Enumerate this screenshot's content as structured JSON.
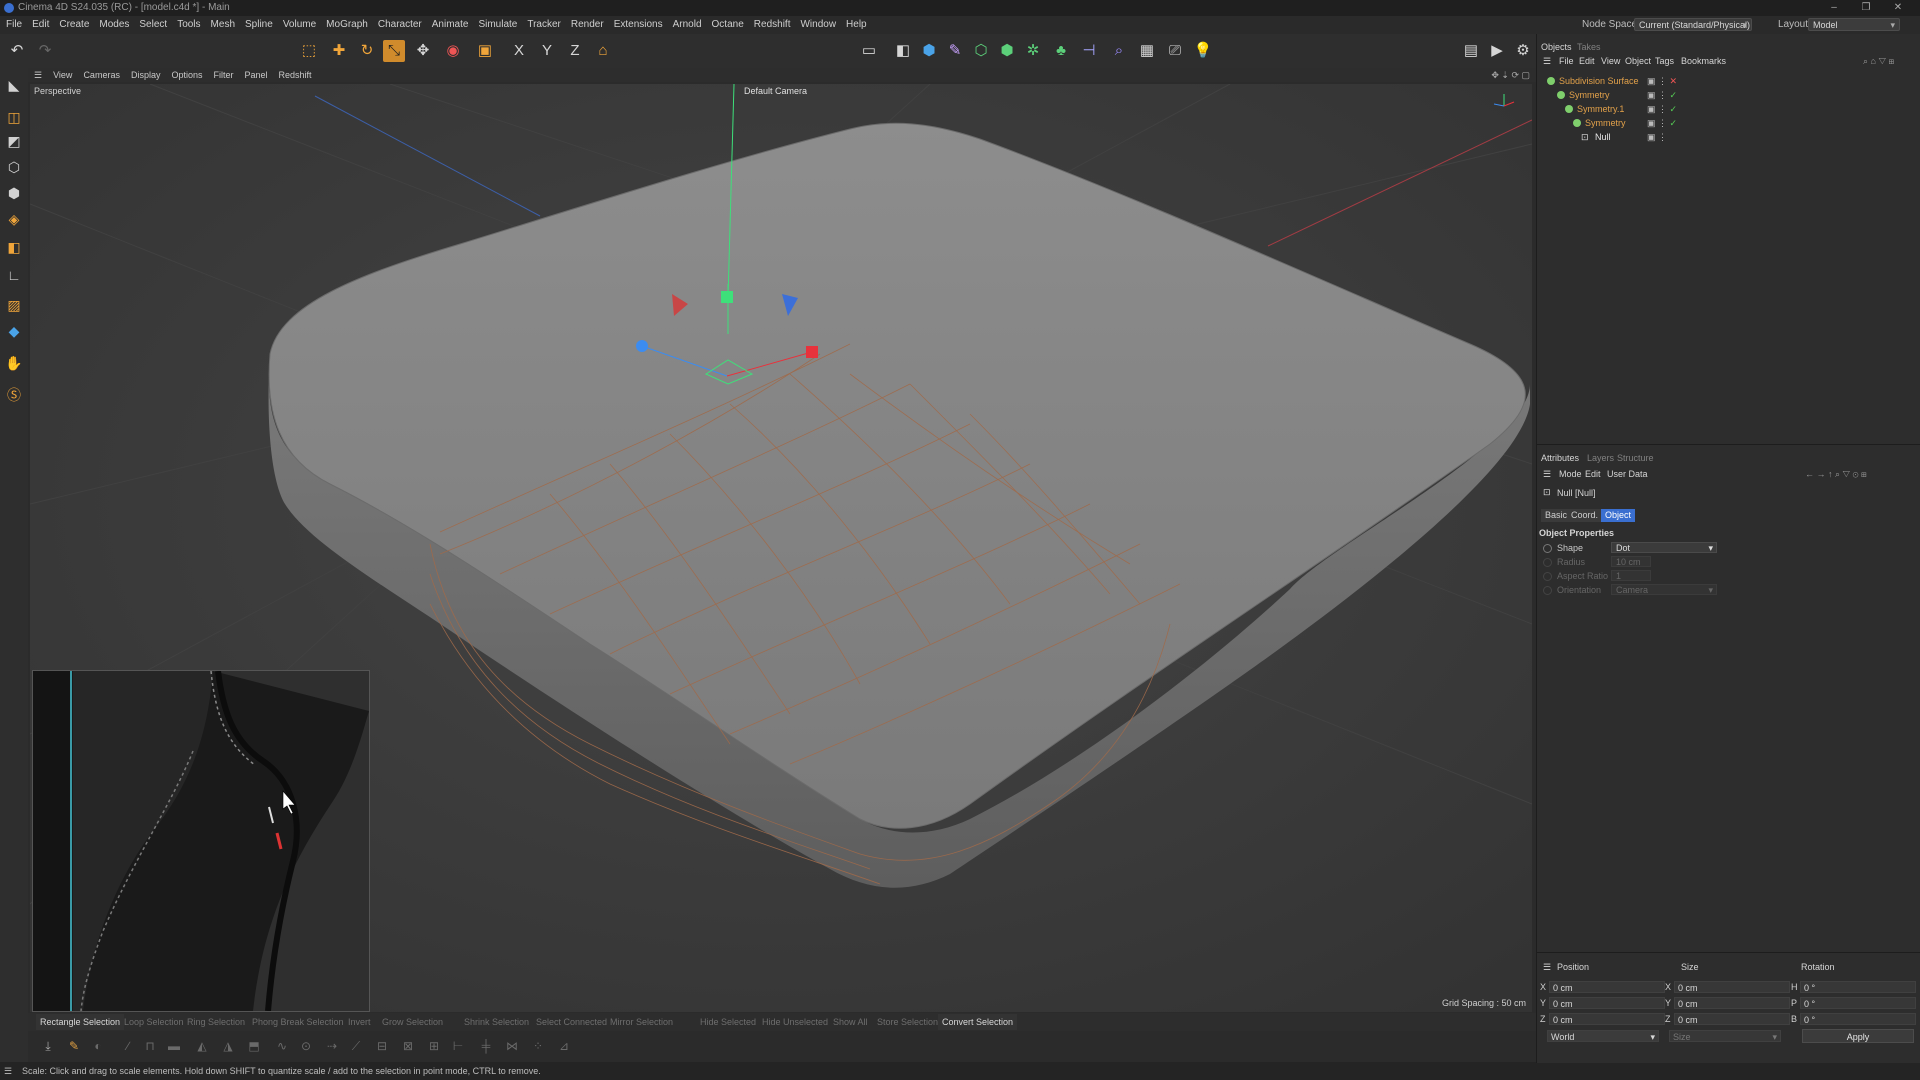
{
  "window": {
    "title": "Cinema 4D S24.035 (RC) - [model.c4d *] - Main"
  },
  "menu": [
    "File",
    "Edit",
    "Create",
    "Modes",
    "Select",
    "Tools",
    "Mesh",
    "Spline",
    "Volume",
    "MoGraph",
    "Character",
    "Animate",
    "Simulate",
    "Tracker",
    "Render",
    "Extensions",
    "Arnold",
    "Octane",
    "Redshift",
    "Window",
    "Help"
  ],
  "node_space": {
    "label": "Node Space:",
    "value": "Current (Standard/Physical)"
  },
  "layout": {
    "label": "Layout:",
    "value": "Model"
  },
  "viewport": {
    "menu": [
      "View",
      "Cameras",
      "Display",
      "Options",
      "Filter",
      "Panel",
      "Redshift"
    ],
    "projection": "Perspective",
    "camera": "Default Camera",
    "grid_spacing": "Grid Spacing : 50 cm"
  },
  "selection_toolbar": [
    {
      "label": "Rectangle Selection",
      "active": true
    },
    {
      "label": "Loop Selection",
      "active": false
    },
    {
      "label": "Ring Selection",
      "active": false
    },
    {
      "label": "Phong Break Selection",
      "active": false
    },
    {
      "label": "Invert",
      "active": false
    },
    {
      "label": "Grow Selection",
      "active": false
    },
    {
      "label": "Shrink Selection",
      "active": false
    },
    {
      "label": "Select Connected",
      "active": false
    },
    {
      "label": "Mirror Selection",
      "active": false
    },
    {
      "label": "Hide Selected",
      "active": false
    },
    {
      "label": "Hide Unselected",
      "active": false
    },
    {
      "label": "Show All",
      "active": false
    },
    {
      "label": "Store Selection",
      "active": false
    },
    {
      "label": "Convert Selection",
      "active": true
    }
  ],
  "status": "Scale: Click and drag to scale elements. Hold down SHIFT to quantize scale / add to the selection in point mode, CTRL to remove.",
  "objects_panel": {
    "tabs": [
      "Objects",
      "Takes"
    ],
    "menu": [
      "File",
      "Edit",
      "View",
      "Object",
      "Tags",
      "Bookmarks"
    ],
    "tree": [
      {
        "name": "Subdivision Surface",
        "depth": 0,
        "color": "#e2a14a"
      },
      {
        "name": "Symmetry",
        "depth": 1,
        "color": "#e2a14a"
      },
      {
        "name": "Symmetry.1",
        "depth": 2,
        "color": "#e2a14a"
      },
      {
        "name": "Symmetry",
        "depth": 3,
        "color": "#e2a14a"
      },
      {
        "name": "Null",
        "depth": 4,
        "color": "#e8e8e8"
      }
    ]
  },
  "attributes_panel": {
    "tabs": [
      "Attributes",
      "Layers",
      "Structure"
    ],
    "menu": [
      "Mode",
      "Edit",
      "User Data"
    ],
    "object_title": "Null [Null]",
    "subtabs": [
      {
        "label": "Basic",
        "selected": false
      },
      {
        "label": "Coord.",
        "selected": false
      },
      {
        "label": "Object",
        "selected": true
      }
    ],
    "section": "Object Properties",
    "properties": [
      {
        "label": "Shape",
        "value": "Dot",
        "enabled": true
      },
      {
        "label": "Radius",
        "value": "10 cm",
        "enabled": false
      },
      {
        "label": "Aspect Ratio",
        "value": "1",
        "enabled": false
      },
      {
        "label": "Orientation",
        "value": "Camera",
        "enabled": false
      }
    ]
  },
  "coordinates": {
    "headers": [
      "Position",
      "Size",
      "Rotation"
    ],
    "rows": [
      {
        "axis": "X",
        "pos": "0 cm",
        "size_axis": "X",
        "size": "0 cm",
        "rot_axis": "H",
        "rot": "0 °"
      },
      {
        "axis": "Y",
        "pos": "0 cm",
        "size_axis": "Y",
        "size": "0 cm",
        "rot_axis": "P",
        "rot": "0 °"
      },
      {
        "axis": "Z",
        "pos": "0 cm",
        "size_axis": "Z",
        "size": "0 cm",
        "rot_axis": "B",
        "rot": "0 °"
      }
    ],
    "mode": "World",
    "size_mode": "Size",
    "apply_label": "Apply"
  },
  "colors": {
    "accent_orange": "#d08b2c",
    "selection_blue": "#3a6fd0",
    "object_orange": "#e2a14a",
    "axis_green": "#3ee07a",
    "axis_red": "#e8323c",
    "axis_blue": "#3c8cf0"
  }
}
